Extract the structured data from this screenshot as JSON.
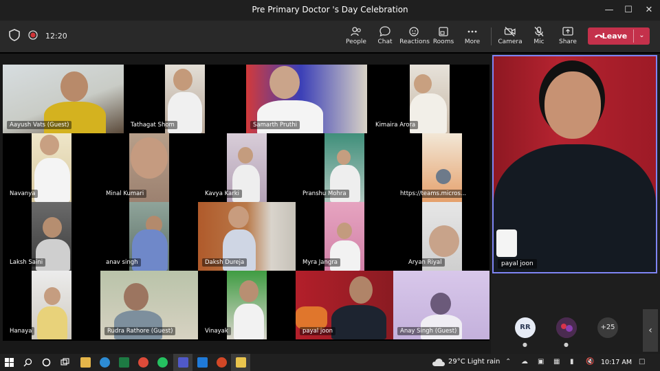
{
  "window": {
    "title": "Pre Primary Doctor 's Day Celebration"
  },
  "toolbar": {
    "timer": "12:20",
    "buttons": {
      "people": "People",
      "chat": "Chat",
      "reactions": "Reactions",
      "rooms": "Rooms",
      "more": "More",
      "camera": "Camera",
      "mic": "Mic",
      "share": "Share"
    },
    "leave": "Leave"
  },
  "participants": [
    "Aayush Vats (Guest)",
    "Tathagat Shom",
    "Samarth Pruthi",
    "Kimaira Arora",
    "Navanya",
    "Minal Kumari",
    "Kavya Karki",
    "Pranshu Mohra",
    "https://teams.micros...",
    "Laksh Saini",
    "anav singh",
    "Daksh Dureja",
    "Myra Jangra",
    "Aryan Riyal",
    "Hanaya",
    "Rudra Rathore (Guest)",
    "Vinayak",
    "payal joon",
    "Anay Singh (Guest)"
  ],
  "spotlight": {
    "name": "payal joon"
  },
  "side": {
    "avatar_initials": "RR",
    "overflow_count": "+25"
  },
  "taskbar": {
    "weather": "29°C  Light rain",
    "time": "10:17 AM"
  }
}
